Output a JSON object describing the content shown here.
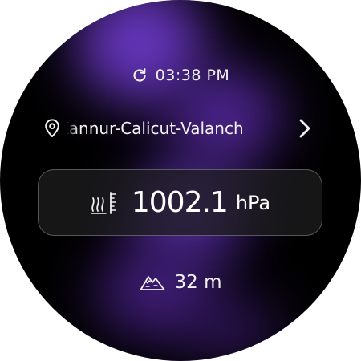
{
  "status": {
    "refresh_icon": "refresh-icon",
    "time": "03:38 PM"
  },
  "location": {
    "pin_icon": "location-pin-icon",
    "name": "Kannur-Calicut-Valanch",
    "next_icon": "chevron-right-icon"
  },
  "pressure": {
    "icon": "barometer-icon",
    "value": "1002.1",
    "unit": "hPa"
  },
  "altitude": {
    "icon": "mountain-icon",
    "value": "32 m"
  },
  "colors": {
    "background": "#000000",
    "glow": "#6a38c4",
    "text": "#f2f2f2",
    "card_border": "#4a4a4a"
  }
}
